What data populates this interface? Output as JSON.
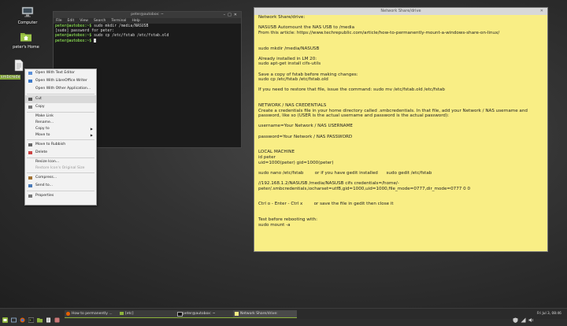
{
  "desktop": {
    "icons": [
      {
        "label": "Computer"
      },
      {
        "label": "peter's Home"
      },
      {
        "label": "smbcredentials"
      }
    ]
  },
  "terminal": {
    "title": "peter@autobox: ~",
    "menu": [
      "File",
      "Edit",
      "View",
      "Search",
      "Terminal",
      "Help"
    ],
    "lines": [
      {
        "prompt": "peter@autobox:~$",
        "text": " sudo mkdir /media/NASUSB"
      },
      {
        "prompt": "",
        "text": "[sudo] password for peter:"
      },
      {
        "prompt": "peter@autobox:~$",
        "text": " sudo cp /etc/fstab /etc/fstab.old"
      },
      {
        "prompt": "peter@autobox:~$",
        "text": " "
      }
    ]
  },
  "note": {
    "title": "Network Share/drive",
    "text": "Network Share/drive:\n\nNASUSB Automount the NAS USB to /media\nFrom this article: https://www.techrepublic.com/article/how-to-permanently-mount-a-windows-share-on-linux/\n\n\nsudo mkdir /media/NASUSB\n\nAlready installed in LM 20:\nsudo apt-get install cifs-utils\n\nSave a copy of fstab before making changes:\nsudo cp /etc/fstab /etc/fstab.old\n\nIf you need to restore that file, issue the command: sudo mv /etc/fstab.old /etc/fstab\n\n\nNETWORK / NAS CREDENTIALS\nCreate a credentials file in your home directory called .smbcredentials. In that file, add your Network / NAS username and password, like so (USER is the actual username and password is the actual password):\n\nusername=Your Network / NAS USERNAME\n\npassword=Your Network / NAS PASSWORD\n\n\nLOCAL MACHINE\nid peter\nuid=1000(peter) gid=1000(peter)\n\nsudo nano /etc/fstab        or if you have gedit installed      sudo gedit /etc/fstab\n\n//192.168.1.2/NASUSB /media/NASUSB cifs credentials=/home/-peter/.smbcredentials,iocharset=utf8,gid=1000,uid=1000,file_mode=0777,dir_mode=0777 0 0\n\n\nCtrl o - Enter - Ctrl x        or save the file in gedit then close it\n\n\nTest before rebooting with:\nsudo mount -a"
  },
  "context_menu": {
    "items": [
      {
        "label": "Open With Text Editor",
        "type": "item",
        "icon": "text-editor-icon"
      },
      {
        "label": "Open With LibreOffice Writer",
        "type": "item",
        "icon": "writer-icon"
      },
      {
        "label": "Open With Other Application...",
        "type": "item",
        "icon": ""
      },
      {
        "label": "",
        "type": "sep"
      },
      {
        "label": "Cut",
        "type": "item",
        "icon": "cut-icon"
      },
      {
        "label": "Copy",
        "type": "item",
        "icon": "copy-icon"
      },
      {
        "label": "",
        "type": "sep"
      },
      {
        "label": "Make Link",
        "type": "small",
        "icon": ""
      },
      {
        "label": "Rename...",
        "type": "small",
        "icon": ""
      },
      {
        "label": "Copy to",
        "type": "small",
        "icon": "",
        "submenu": true
      },
      {
        "label": "Move to",
        "type": "small",
        "icon": "",
        "submenu": true
      },
      {
        "label": "",
        "type": "sep"
      },
      {
        "label": "Move to Rubbish",
        "type": "item",
        "icon": "trash-icon"
      },
      {
        "label": "Delete",
        "type": "item",
        "icon": "delete-icon"
      },
      {
        "label": "",
        "type": "sep"
      },
      {
        "label": "Resize Icon...",
        "type": "small",
        "icon": ""
      },
      {
        "label": "Restore Icon's Original Size",
        "type": "small-disabled",
        "icon": ""
      },
      {
        "label": "",
        "type": "sep"
      },
      {
        "label": "Compress...",
        "type": "item",
        "icon": "compress-icon"
      },
      {
        "label": "Send to...",
        "type": "item",
        "icon": "send-icon"
      },
      {
        "label": "",
        "type": "sep"
      },
      {
        "label": "Properties",
        "type": "item",
        "icon": "properties-icon"
      }
    ]
  },
  "taskbar": {
    "windows": [
      {
        "label": "How to permanently ...",
        "active": false
      },
      {
        "label": "[etc]",
        "active": false
      },
      {
        "label": "peter@autobox: ~",
        "active": false
      },
      {
        "label": "Network Share/drive:",
        "active": true
      }
    ],
    "clock": "Fri Jul 3, 08:46"
  },
  "colors": {
    "accent": "#8db33c",
    "note_bg": "#f9ee85",
    "terminal_bg": "#1b1b1b"
  }
}
